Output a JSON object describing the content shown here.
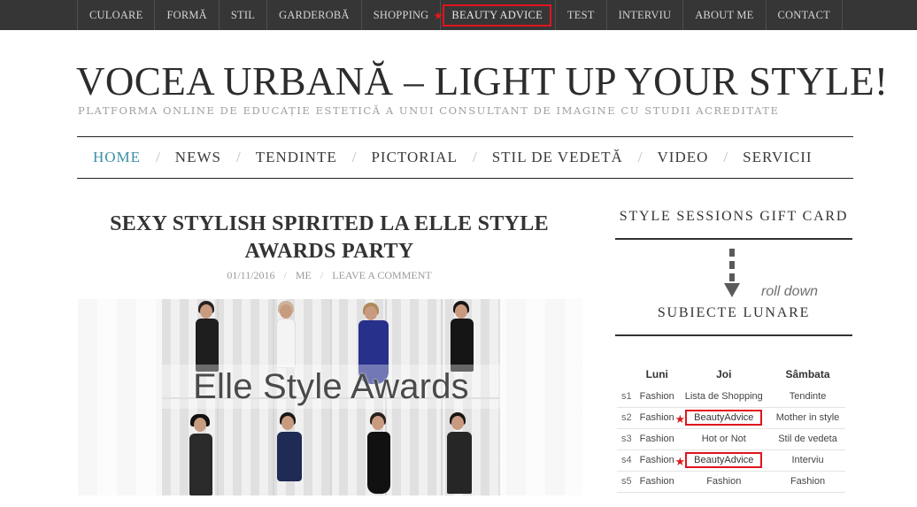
{
  "top_nav": {
    "items": [
      {
        "label": "CULOARE"
      },
      {
        "label": "FORMĂ"
      },
      {
        "label": "STIL"
      },
      {
        "label": "GARDEROBĂ"
      },
      {
        "label": "SHOPPING"
      },
      {
        "label": "BEAUTY ADVICE",
        "highlighted": true
      },
      {
        "label": "TEST"
      },
      {
        "label": "INTERVIU"
      },
      {
        "label": "ABOUT ME"
      },
      {
        "label": "CONTACT"
      }
    ]
  },
  "header": {
    "title": "VOCEA URBANĂ – LIGHT UP YOUR STYLE!",
    "tagline": "PLATFORMA ONLINE DE EDUCAȚIE ESTETICĂ A UNUI CONSULTANT DE IMAGINE CU STUDII ACREDITATE"
  },
  "main_nav": {
    "separator": "/",
    "items": [
      {
        "label": "HOME",
        "active": true
      },
      {
        "label": "NEWS"
      },
      {
        "label": "TENDINTE"
      },
      {
        "label": "PICTORIAL"
      },
      {
        "label": "STIL DE VEDETĂ"
      },
      {
        "label": "VIDEO"
      },
      {
        "label": "SERVICII"
      }
    ]
  },
  "post": {
    "title": "SEXY STYLISH SPIRITED LA ELLE STYLE AWARDS PARTY",
    "date": "01/11/2016",
    "author": "ME",
    "comment_link": "LEAVE A COMMENT",
    "image_overlay_text": "Elle Style Awards"
  },
  "sidebar": {
    "widget1_title": "STYLE SESSIONS GIFT CARD",
    "roll_down_text": "roll down",
    "widget2_title": "SUBIECTE LUNARE",
    "schedule": {
      "headers": [
        "",
        "Luni",
        "Joi",
        "Sâmbata"
      ],
      "rows": [
        {
          "label": "s1",
          "luni": "Fashion",
          "joi": "Lista de Shopping",
          "sambata": "Tendinte"
        },
        {
          "label": "s2",
          "luni": "Fashion",
          "joi": "BeautyAdvice",
          "sambata": "Mother in style",
          "joi_highlighted": true
        },
        {
          "label": "s3",
          "luni": "Fashion",
          "joi": "Hot or Not",
          "sambata": "Stil de vedeta"
        },
        {
          "label": "s4",
          "luni": "Fashion",
          "joi": "BeautyAdvice",
          "sambata": "Interviu",
          "joi_highlighted": true
        },
        {
          "label": "s5",
          "luni": "Fashion",
          "joi": "Fashion",
          "sambata": "Fashion"
        }
      ]
    }
  },
  "colors": {
    "topbar_bg": "#363636",
    "accent_active": "#3b8fa3",
    "highlight_red": "#e0141e"
  },
  "icons": {
    "highlight_marker": "red-star-icon",
    "roll_down_indicator": "dashed-arrow-down-icon"
  }
}
